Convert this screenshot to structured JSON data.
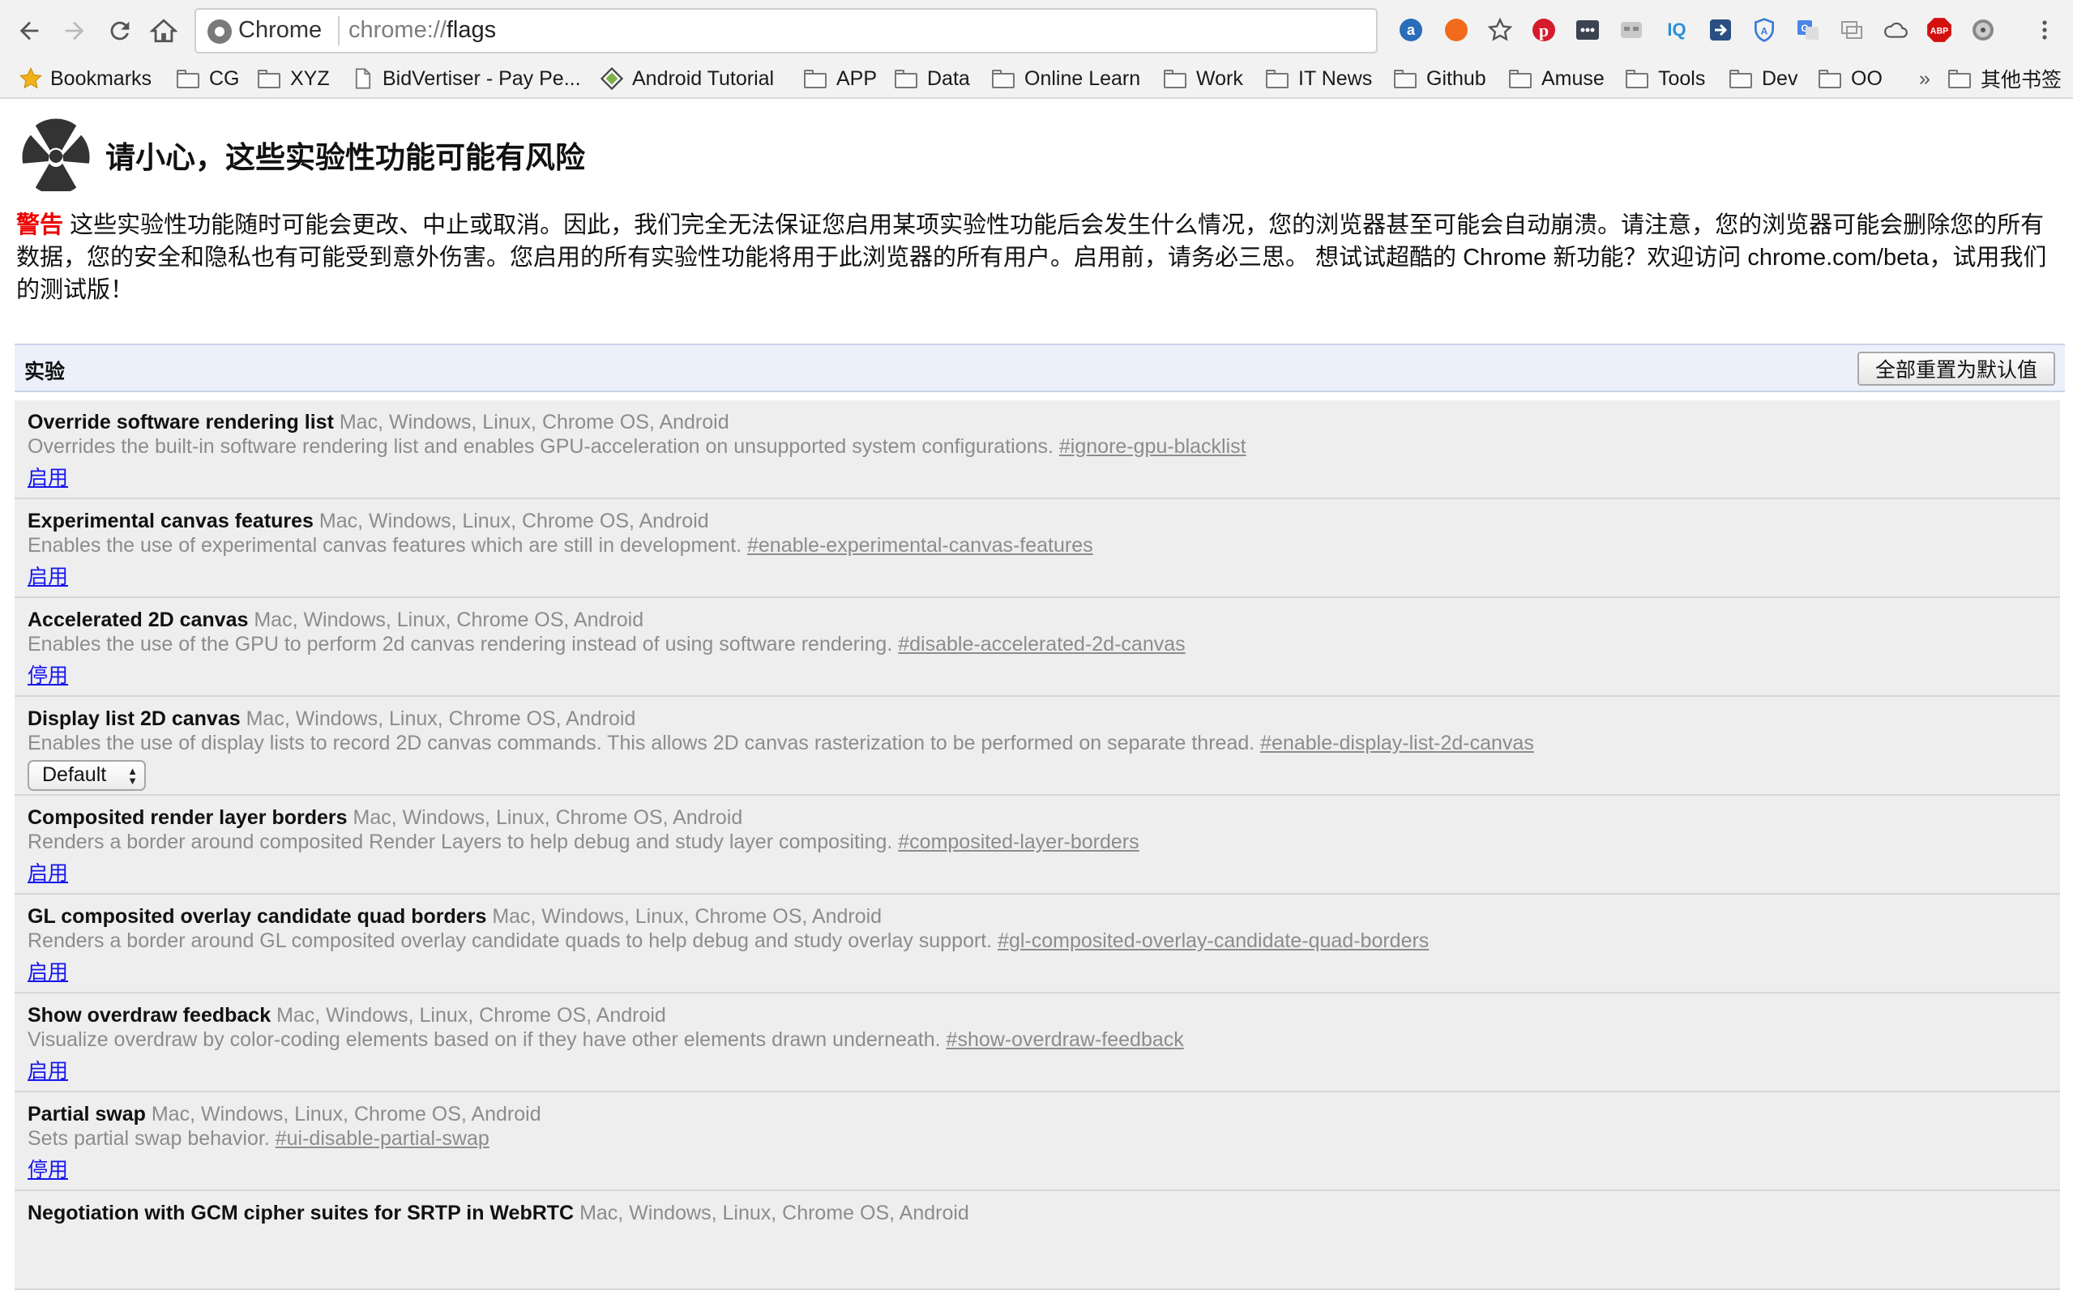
{
  "browser": {
    "site_label": "Chrome",
    "url_scheme": "chrome://",
    "url_host": "flags",
    "extensions": [
      "extension-a-icon",
      "extension-swirl-icon",
      "bookmark-star-icon",
      "pinterest-icon",
      "extension-dots-icon",
      "extension-mask-icon",
      "iq-icon",
      "extension-arrow-icon",
      "shield-icon",
      "translate-icon",
      "extension-window-icon",
      "cloud-icon",
      "abp-icon",
      "extension-film-icon",
      "menu-icon"
    ]
  },
  "bookmarks": [
    {
      "label": "Bookmarks",
      "icon": "star"
    },
    {
      "label": "CG",
      "icon": "folder"
    },
    {
      "label": "XYZ",
      "icon": "folder"
    },
    {
      "label": "BidVertiser - Pay Pe...",
      "icon": "page"
    },
    {
      "label": "Android Tutorial",
      "icon": "diamond"
    },
    {
      "label": "APP",
      "icon": "folder"
    },
    {
      "label": "Data",
      "icon": "folder"
    },
    {
      "label": "Online Learn",
      "icon": "folder"
    },
    {
      "label": "Work",
      "icon": "folder"
    },
    {
      "label": "IT News",
      "icon": "folder"
    },
    {
      "label": "Github",
      "icon": "folder"
    },
    {
      "label": "Amuse",
      "icon": "folder"
    },
    {
      "label": "Tools",
      "icon": "folder"
    },
    {
      "label": "Dev",
      "icon": "folder"
    },
    {
      "label": "OO",
      "icon": "folder"
    }
  ],
  "bookmarks_overflow": "»",
  "other_bookmarks": "其他书签",
  "warning": {
    "title": "请小心，这些实验性功能可能有风险",
    "label": "警告",
    "text": " 这些实验性功能随时可能会更改、中止或取消。因此，我们完全无法保证您启用某项实验性功能后会发生什么情况，您的浏览器甚至可能会自动崩溃。请注意，您的浏览器可能会删除您的所有数据，您的安全和隐私也有可能受到意外伤害。您启用的所有实验性功能将用于此浏览器的所有用户。启用前，请务必三思。 想试试超酷的 Chrome 新功能？欢迎访问 chrome.com/beta，试用我们的测试版！"
  },
  "experiments": {
    "title": "实验",
    "reset_label": "全部重置为默认值",
    "items": [
      {
        "name": "Override software rendering list",
        "platforms": "Mac, Windows, Linux, Chrome OS, Android",
        "desc": "Overrides the built-in software rendering list and enables GPU-acceleration on unsupported system configurations.",
        "anchor": "#ignore-gpu-blacklist",
        "action": "启用"
      },
      {
        "name": "Experimental canvas features",
        "platforms": "Mac, Windows, Linux, Chrome OS, Android",
        "desc": "Enables the use of experimental canvas features which are still in development.",
        "anchor": "#enable-experimental-canvas-features",
        "action": "启用"
      },
      {
        "name": "Accelerated 2D canvas",
        "platforms": "Mac, Windows, Linux, Chrome OS, Android",
        "desc": "Enables the use of the GPU to perform 2d canvas rendering instead of using software rendering.",
        "anchor": "#disable-accelerated-2d-canvas",
        "action": "停用"
      },
      {
        "name": "Display list 2D canvas",
        "platforms": "Mac, Windows, Linux, Chrome OS, Android",
        "desc": "Enables the use of display lists to record 2D canvas commands. This allows 2D canvas rasterization to be performed on separate thread.",
        "anchor": "#enable-display-list-2d-canvas",
        "select": "Default"
      },
      {
        "name": "Composited render layer borders",
        "platforms": "Mac, Windows, Linux, Chrome OS, Android",
        "desc": "Renders a border around composited Render Layers to help debug and study layer compositing.",
        "anchor": "#composited-layer-borders",
        "action": "启用"
      },
      {
        "name": "GL composited overlay candidate quad borders",
        "platforms": "Mac, Windows, Linux, Chrome OS, Android",
        "desc": "Renders a border around GL composited overlay candidate quads to help debug and study overlay support.",
        "anchor": "#gl-composited-overlay-candidate-quad-borders",
        "action": "启用"
      },
      {
        "name": "Show overdraw feedback",
        "platforms": "Mac, Windows, Linux, Chrome OS, Android",
        "desc": "Visualize overdraw by color-coding elements based on if they have other elements drawn underneath.",
        "anchor": "#show-overdraw-feedback",
        "action": "启用"
      },
      {
        "name": "Partial swap",
        "platforms": "Mac, Windows, Linux, Chrome OS, Android",
        "desc": "Sets partial swap behavior.",
        "anchor": "#ui-disable-partial-swap",
        "action": "停用"
      },
      {
        "name": "Negotiation with GCM cipher suites for SRTP in WebRTC",
        "platforms": "Mac, Windows, Linux, Chrome OS, Android",
        "desc": "",
        "anchor": "",
        "action": ""
      }
    ]
  }
}
